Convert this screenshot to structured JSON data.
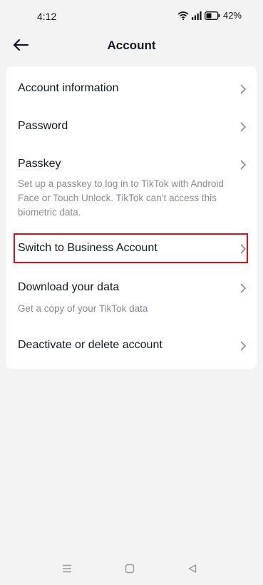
{
  "status_bar": {
    "time": "4:12",
    "battery": "42%",
    "icons": [
      "wifi-icon",
      "signal-icon",
      "battery-icon"
    ]
  },
  "header": {
    "title": "Account",
    "back_icon": "back-arrow-icon"
  },
  "menu": {
    "items": [
      {
        "label": "Account information",
        "description": ""
      },
      {
        "label": "Password",
        "description": ""
      },
      {
        "label": "Passkey",
        "description": "Set up a passkey to log in to TikTok with Android Face or Touch Unlock. TikTok can’t access this biometric data."
      },
      {
        "label": "Switch to Business Account",
        "description": ""
      },
      {
        "label": "Download your data",
        "description": "Get a copy of your TikTok data"
      },
      {
        "label": "Deactivate or delete account",
        "description": ""
      }
    ]
  },
  "highlight": {
    "target": "Switch to Business Account",
    "color": "#d4121a"
  },
  "nav_bar": {
    "icons": [
      "menu-icon",
      "home-icon",
      "back-icon"
    ]
  },
  "colors": {
    "background": "#f3f3f3",
    "card": "#ffffff",
    "text_primary": "#161823",
    "text_secondary": "#8a8b91",
    "chevron": "#8a8b91"
  }
}
